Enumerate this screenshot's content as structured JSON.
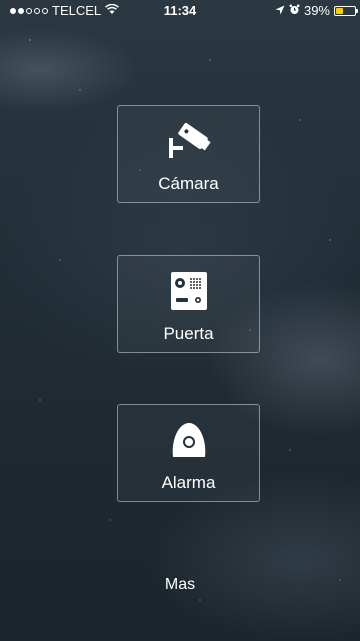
{
  "status_bar": {
    "carrier": "TELCEL",
    "time": "11:34",
    "battery_percent": "39%",
    "battery_level": 0.39,
    "battery_color": "#f5d100",
    "signal_bars_filled": 2,
    "signal_bars_total": 5
  },
  "menu": {
    "camera_label": "Cámara",
    "door_label": "Puerta",
    "alarm_label": "Alarma",
    "more_label": "Mas"
  },
  "icons": {
    "camera": "security-camera-icon",
    "door": "intercom-panel-icon",
    "alarm": "alarm-sensor-icon",
    "wifi": "wifi-icon",
    "location": "location-arrow-icon",
    "clock": "alarm-clock-icon",
    "battery": "battery-icon"
  },
  "colors": {
    "text": "#ffffff",
    "tile_border": "rgba(210,215,220,0.55)"
  }
}
